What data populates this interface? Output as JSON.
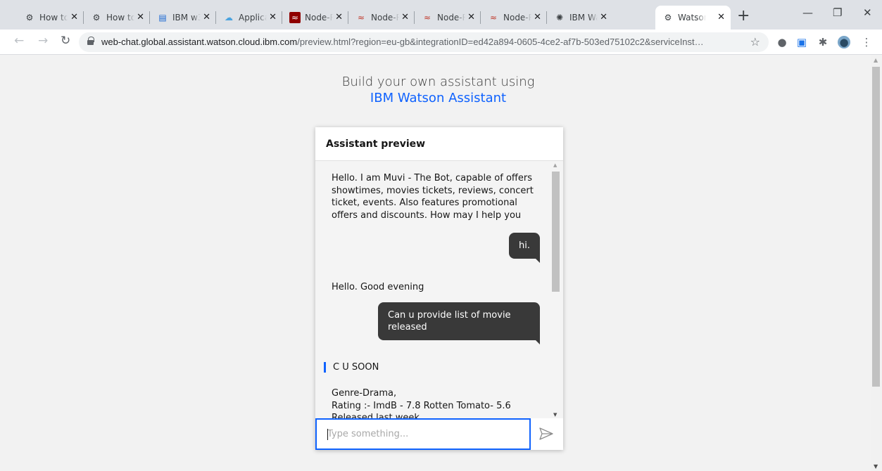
{
  "browser": {
    "tabs": [
      {
        "title": "How to",
        "icon": "node-red-icon"
      },
      {
        "title": "How to",
        "icon": "node-red-icon"
      },
      {
        "title": "IBM w3",
        "icon": "ibm-w3-icon"
      },
      {
        "title": "Applica",
        "icon": "cloud-icon"
      },
      {
        "title": "Node-R",
        "icon": "node-red-icon"
      },
      {
        "title": "Node-R",
        "icon": "node-red-icon"
      },
      {
        "title": "Node-R",
        "icon": "node-red-icon"
      },
      {
        "title": "Node-R",
        "icon": "node-red-icon"
      },
      {
        "title": "IBM Wa",
        "icon": "watson-icon"
      },
      {
        "title": "Watson",
        "icon": "node-red-icon"
      }
    ],
    "new_tab": "+",
    "url_host": "web-chat.global.assistant.watson.cloud.ibm.com",
    "url_path": "/preview.html?region=eu-gb&integrationID=ed42a894-0605-4ce2-af7b-503ed75102c2&serviceInst…"
  },
  "page": {
    "heading_line1": "Build your own assistant using",
    "heading_link": "IBM Watson Assistant"
  },
  "chat": {
    "header_title": "Assistant preview",
    "messages": [
      {
        "from": "bot",
        "text": "Hello. I am Muvi - The Bot, capable of offers showtimes, movies tickets, reviews, concert ticket, events. Also features promotional offers and discounts. How may I help you"
      },
      {
        "from": "user",
        "text": "hi."
      },
      {
        "from": "bot",
        "text": "Hello. Good evening"
      },
      {
        "from": "user",
        "text": "Can u provide list of movie released"
      }
    ],
    "option_title": "C U SOON",
    "option_details": [
      "Genre-Drama,",
      "Rating :- ImdB - 7.8 Rotten Tomato- 5.6",
      "Released last week"
    ],
    "input_placeholder": "Type something..."
  },
  "colors": {
    "accent": "#0f62fe",
    "user_bubble": "#393939",
    "panel_bg": "#f4f4f4"
  }
}
